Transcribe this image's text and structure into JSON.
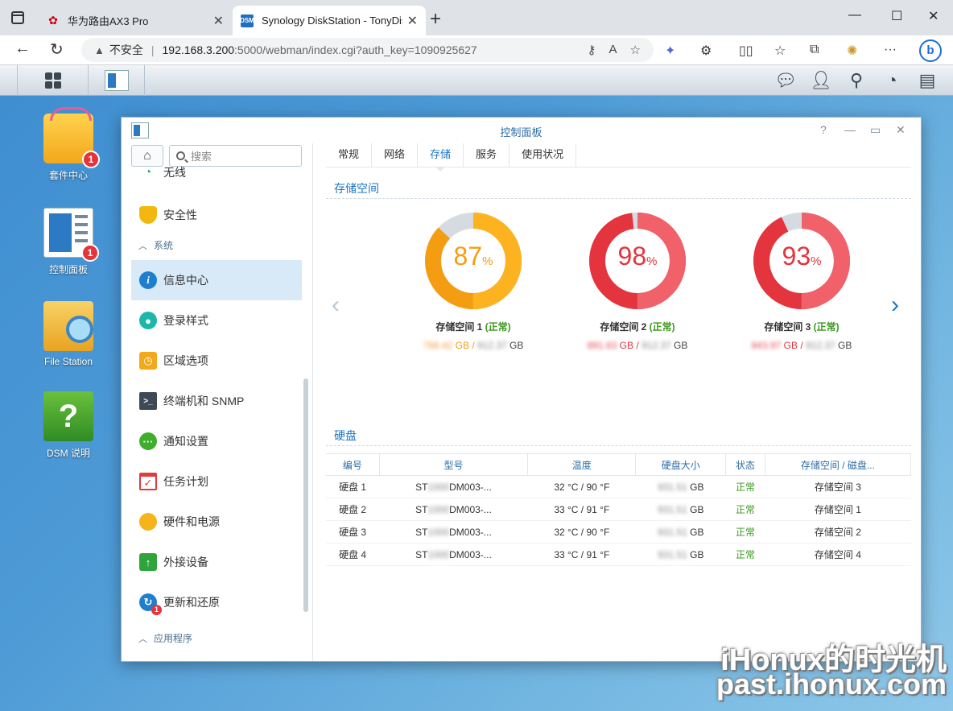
{
  "browser": {
    "tabs": [
      {
        "title": "华为路由AX3 Pro",
        "favicon": "huawei-logo-icon"
      },
      {
        "title": "Synology DiskStation - TonyDiskS",
        "favicon": "dsm-icon",
        "favicon_text": "DSM"
      }
    ],
    "security_label": "不安全",
    "url_host": "192.168.3.200",
    "url_rest": ":5000/webman/index.cgi?auth_key=1090925627"
  },
  "desktop": {
    "icons": [
      {
        "label": "套件中心",
        "badge": "1"
      },
      {
        "label": "控制面板",
        "badge": "1"
      },
      {
        "label": "File Station",
        "badge": ""
      },
      {
        "label": "DSM 说明",
        "badge": ""
      }
    ]
  },
  "window": {
    "title": "控制面板",
    "controls": {
      "help": "?",
      "minimize": "—",
      "maximize": "▭",
      "close": "✕"
    }
  },
  "sidebar": {
    "search_placeholder": "搜索",
    "items": [
      {
        "label": "无线",
        "icon": "wifi-icon"
      },
      {
        "label": "安全性",
        "icon": "shield-icon"
      },
      {
        "label": "信息中心",
        "icon": "info-icon"
      },
      {
        "label": "登录样式",
        "icon": "palette-icon"
      },
      {
        "label": "区域选项",
        "icon": "region-clock-icon"
      },
      {
        "label": "终端机和 SNMP",
        "icon": "terminal-icon"
      },
      {
        "label": "通知设置",
        "icon": "chat-bubble-icon"
      },
      {
        "label": "任务计划",
        "icon": "calendar-icon"
      },
      {
        "label": "硬件和电源",
        "icon": "bulb-icon"
      },
      {
        "label": "外接设备",
        "icon": "external-device-icon"
      },
      {
        "label": "更新和还原",
        "icon": "update-icon",
        "badge": "1"
      }
    ],
    "headers": {
      "system": "系统",
      "apps": "应用程序"
    }
  },
  "main": {
    "tabs": [
      "常规",
      "网络",
      "存储",
      "服务",
      "使用状况"
    ],
    "active_tab": "存储",
    "storage_title": "存储空间",
    "disk_title": "硬盘",
    "volumes": [
      {
        "percent": "87",
        "unit": "%",
        "name": "存储空间 1",
        "status": "(正常)",
        "used": "788.42",
        "total": "912.37",
        "gb": "GB",
        "color": "#f59d12",
        "accent": "#fdb31f"
      },
      {
        "percent": "98",
        "unit": "%",
        "name": "存储空间 2",
        "status": "(正常)",
        "used": "891.63",
        "total": "912.37",
        "gb": "GB",
        "color": "#e4343e",
        "accent": "#f1616a"
      },
      {
        "percent": "93",
        "unit": "%",
        "name": "存储空间 3",
        "status": "(正常)",
        "used": "843.97",
        "total": "912.37",
        "gb": "GB",
        "color": "#e4343e",
        "accent": "#f1616a"
      }
    ],
    "disk_columns": [
      "编号",
      "型号",
      "温度",
      "硬盘大小",
      "状态",
      "存储空间 / 磁盘..."
    ],
    "disks": [
      {
        "id": "硬盘 1",
        "model_a": "ST",
        "model_mask": "1000",
        "model_b": "DM003-...",
        "temp": "32 °C / 90 °F",
        "size": "931.51",
        "gb": "GB",
        "status": "正常",
        "volume": "存储空间 3"
      },
      {
        "id": "硬盘 2",
        "model_a": "ST",
        "model_mask": "1000",
        "model_b": "DM003-...",
        "temp": "33 °C / 91 °F",
        "size": "931.51",
        "gb": "GB",
        "status": "正常",
        "volume": "存储空间 1"
      },
      {
        "id": "硬盘 3",
        "model_a": "ST",
        "model_mask": "1000",
        "model_b": "DM003-...",
        "temp": "32 °C / 90 °F",
        "size": "931.51",
        "gb": "GB",
        "status": "正常",
        "volume": "存储空间 2"
      },
      {
        "id": "硬盘 4",
        "model_a": "ST",
        "model_mask": "1000",
        "model_b": "DM003-...",
        "temp": "33 °C / 91 °F",
        "size": "931.51",
        "gb": "GB",
        "status": "正常",
        "volume": "存储空间 4"
      }
    ]
  },
  "watermark": {
    "line1": "iHonux的时光机",
    "line2": "past.ihonux.com"
  },
  "colors": {
    "accent": "#1a76c4",
    "ok": "#3c9a1e",
    "desktop": "#4d9ad6"
  }
}
